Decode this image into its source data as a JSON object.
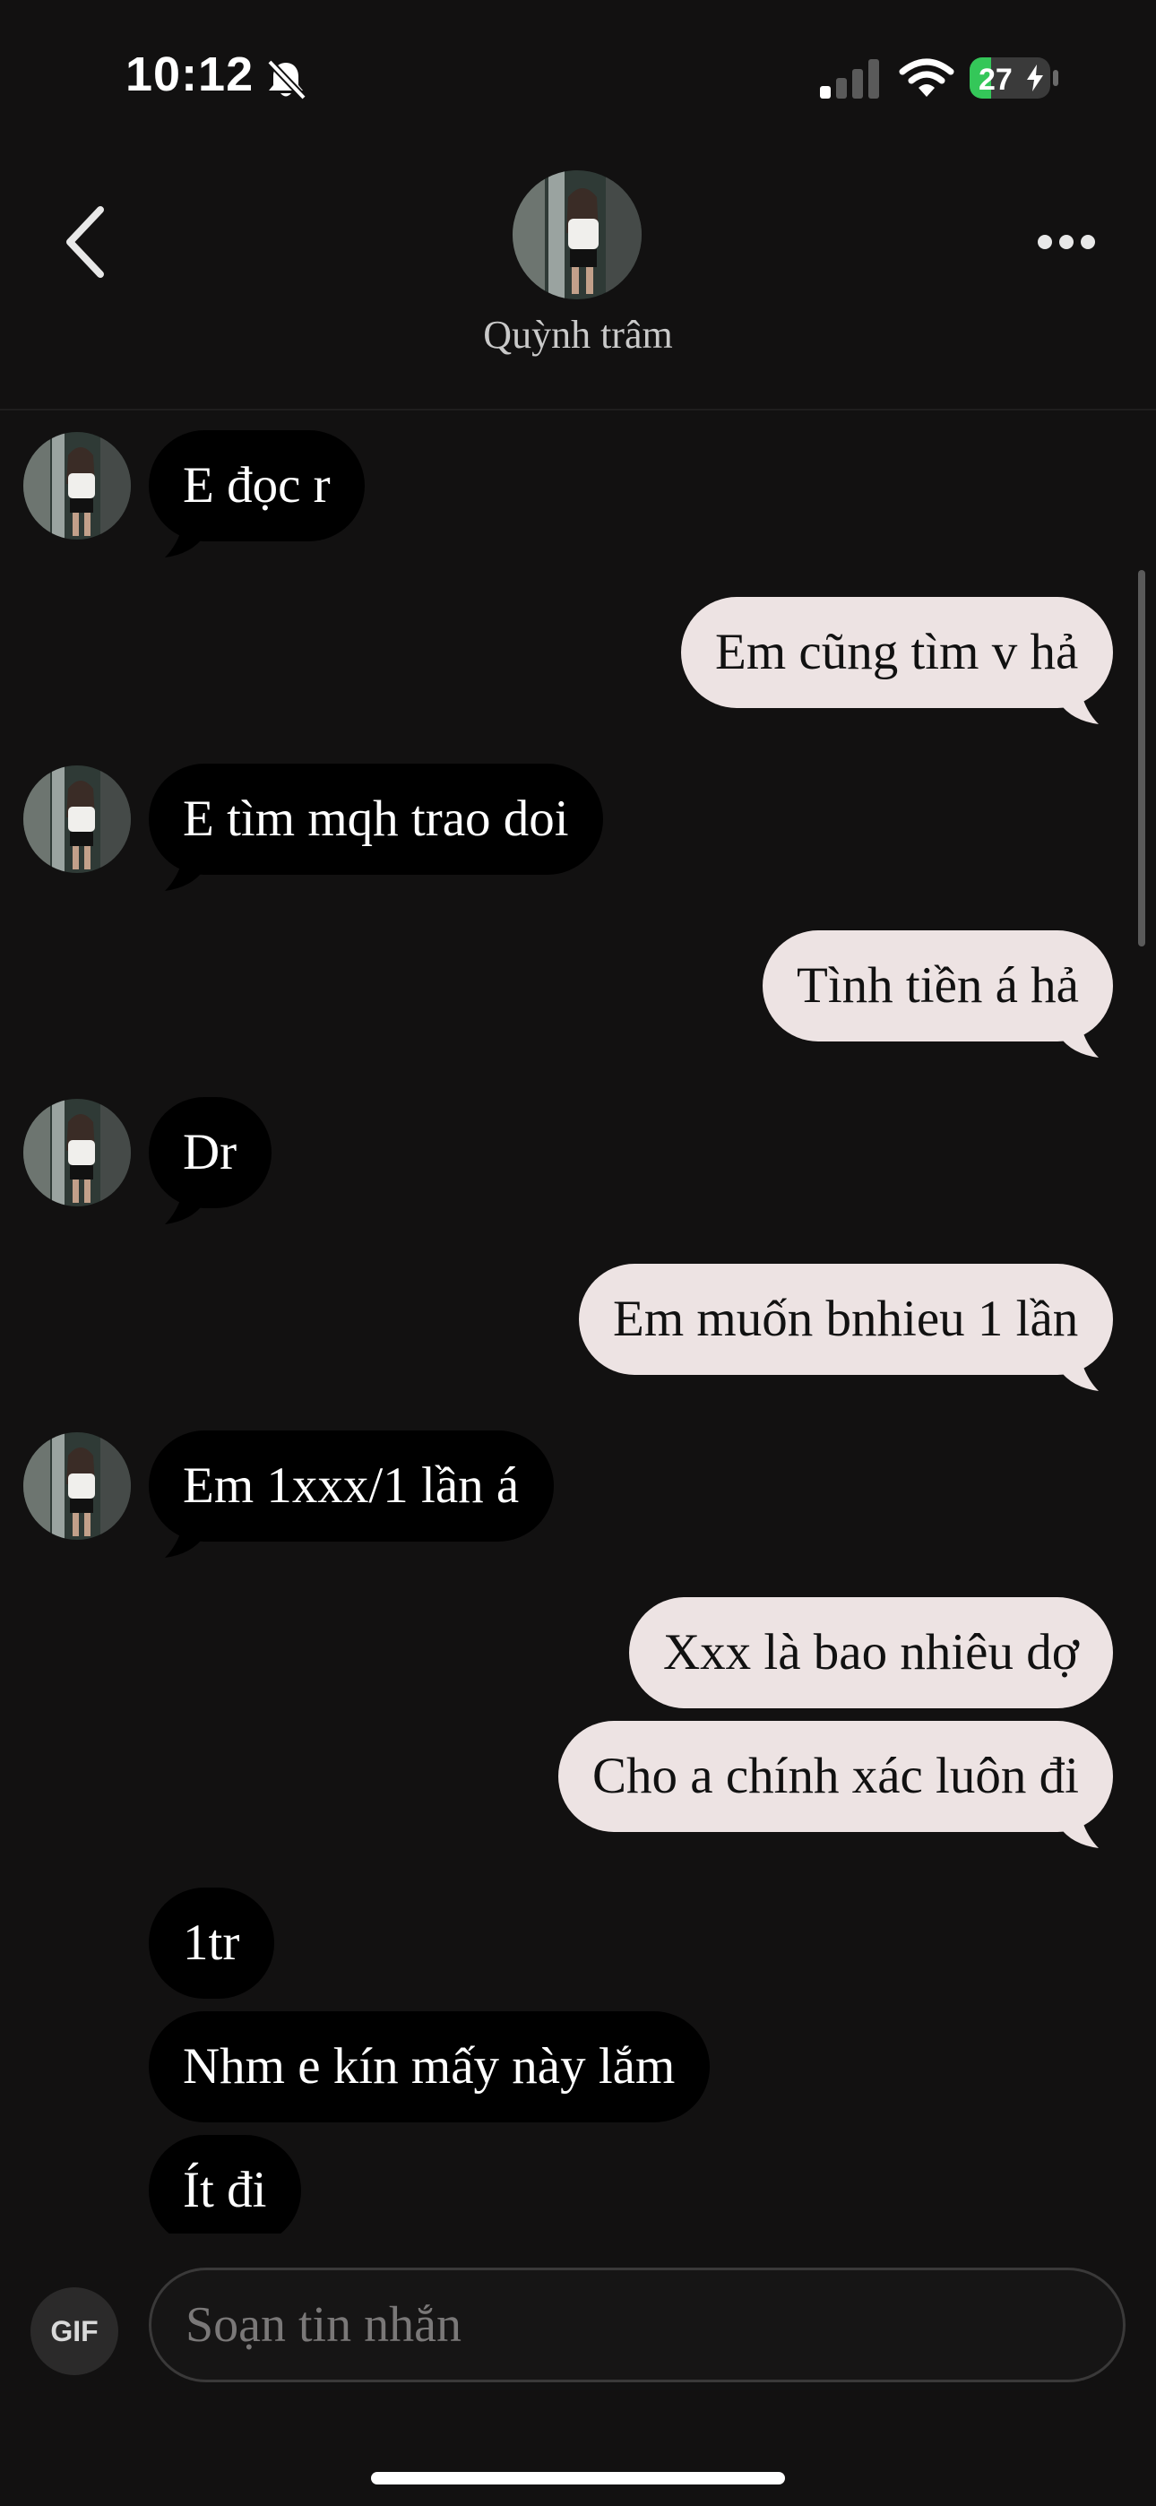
{
  "status_bar": {
    "time": "10:12",
    "battery_percent": "27",
    "battery_level": 0.27,
    "signal_bars_active": 1,
    "icons": [
      "bell-slash-icon",
      "cellular-signal-icon",
      "wifi-icon",
      "battery-charging-icon"
    ]
  },
  "header": {
    "contact_name": "Quỳnh trâm",
    "icons": [
      "chevron-left-icon",
      "more-horizontal-icon"
    ]
  },
  "messages": [
    {
      "side": "in",
      "text": "E đọc r"
    },
    {
      "side": "out",
      "text": "Em cũng tìm v hả"
    },
    {
      "side": "in",
      "text": "E tìm mqh trao doi"
    },
    {
      "side": "out",
      "text": "Tình tiền á hả"
    },
    {
      "side": "in",
      "text": "Dr"
    },
    {
      "side": "out",
      "text": "Em muốn bnhieu 1 lần"
    },
    {
      "side": "in",
      "text": "Em 1xxx/1 lần á"
    },
    {
      "side": "out",
      "text": "Xxx là bao nhiêu dợ"
    },
    {
      "side": "out",
      "text": "Cho a chính xác luôn đi"
    },
    {
      "side": "in",
      "text": "1tr"
    },
    {
      "side": "in",
      "text": "Nhm e kín mấy này lắm"
    },
    {
      "side": "in",
      "text": "Ít đi"
    }
  ],
  "composer": {
    "gif_label": "GIF",
    "placeholder": "Soạn tin nhắn"
  },
  "colors": {
    "background": "#121111",
    "incoming_bubble": "#000000",
    "outgoing_bubble": "#ede3e3",
    "battery_green": "#34c759"
  }
}
